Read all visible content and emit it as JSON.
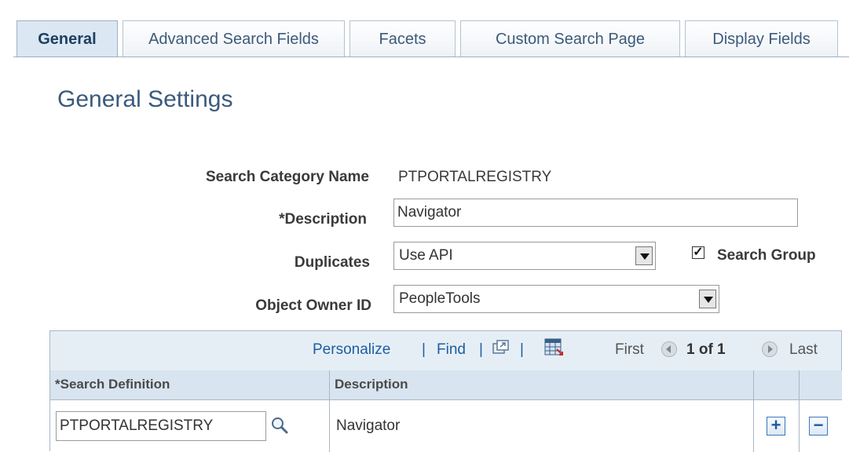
{
  "tabs": [
    {
      "label": "General"
    },
    {
      "label": "Advanced Search Fields"
    },
    {
      "label": "Facets"
    },
    {
      "label": "Custom Search Page"
    },
    {
      "label": "Display Fields"
    }
  ],
  "page_title": "General Settings",
  "form": {
    "category_name_label": "Search Category Name",
    "category_name_value": "PTPORTALREGISTRY",
    "description_label": "*Description",
    "description_value": "Navigator",
    "duplicates_label": "Duplicates",
    "duplicates_value": "Use API",
    "search_group_label": "Search Group",
    "search_group_checked": true,
    "object_owner_label": "Object Owner ID",
    "object_owner_value": "PeopleTools"
  },
  "grid": {
    "personalize": "Personalize",
    "find": "Find",
    "separator": "|",
    "first": "First",
    "pager": "1 of 1",
    "last": "Last",
    "columns": [
      "*Search Definition",
      "Description"
    ],
    "rows": [
      {
        "search_definition": "PTPORTALREGISTRY",
        "description": "Navigator"
      }
    ]
  }
}
